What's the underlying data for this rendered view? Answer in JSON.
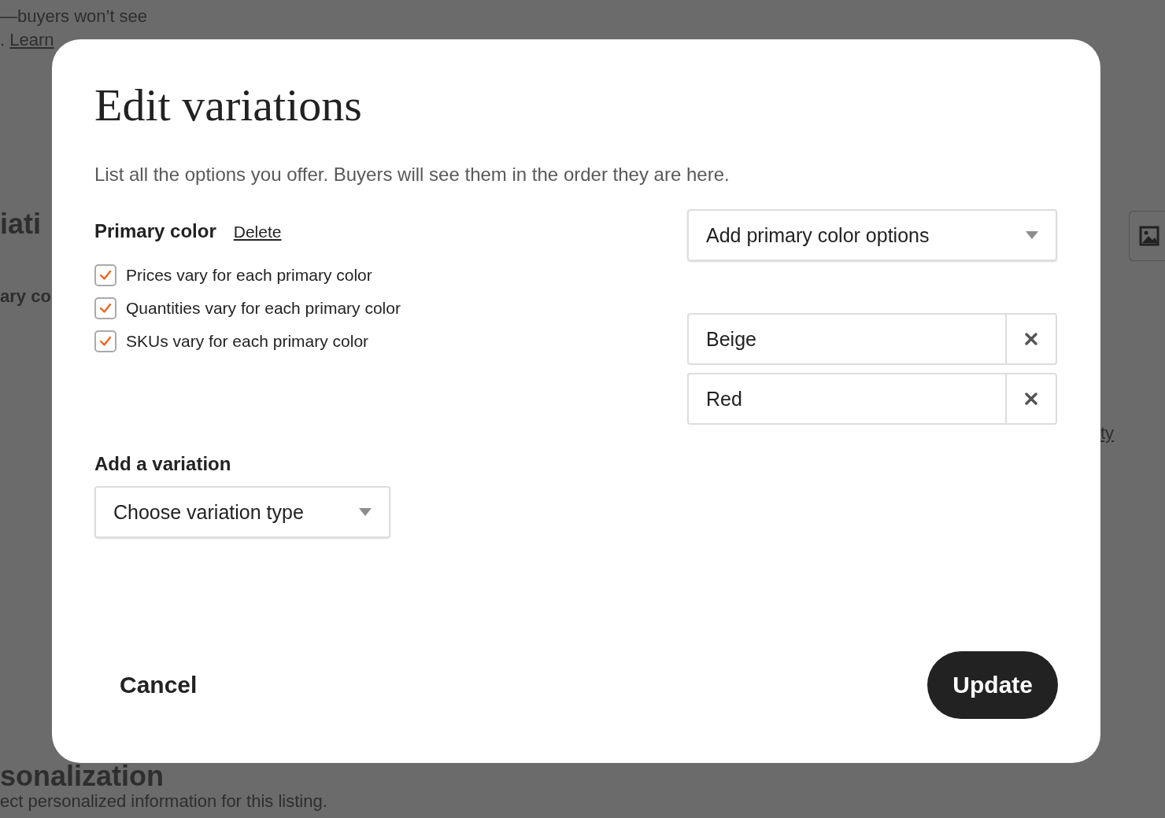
{
  "background": {
    "texts": [
      {
        "kind": "body",
        "text": "—buyers won’t see"
      },
      {
        "kind": "link",
        "text": ". ",
        "link": "Learn"
      },
      {
        "kind": "heading",
        "text": "iati"
      },
      {
        "kind": "label",
        "text": "ary co"
      },
      {
        "kind": "heading",
        "text": "sonalization"
      },
      {
        "kind": "body",
        "text": "ect personalized information for this listing."
      }
    ],
    "side_link": "ty"
  },
  "dialog": {
    "title": "Edit variations",
    "description": "List all the options you offer. Buyers will see them in the order they are here.",
    "variation": {
      "name": "Primary color",
      "delete": "Delete",
      "checkboxes": [
        {
          "label": "Prices vary for each primary color",
          "checked": true
        },
        {
          "label": "Quantities vary for each primary color",
          "checked": true
        },
        {
          "label": "SKUs vary for each primary color",
          "checked": true
        }
      ],
      "options_select": {
        "placeholder": "Add primary color options"
      },
      "options": [
        "Beige",
        "Red"
      ]
    },
    "add_variation": {
      "label": "Add a variation",
      "select": {
        "placeholder": "Choose variation type"
      }
    },
    "cancel": "Cancel",
    "update": "Update"
  }
}
